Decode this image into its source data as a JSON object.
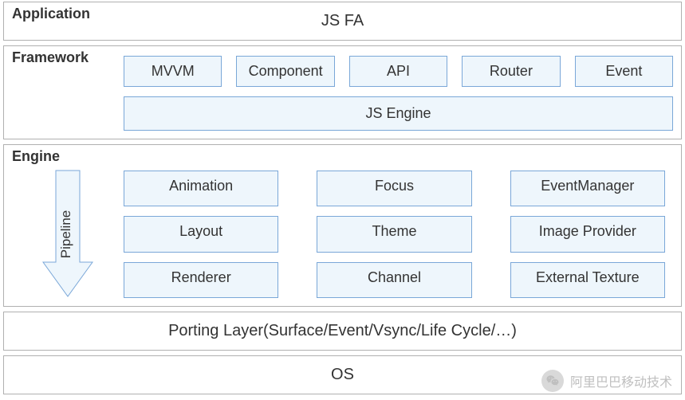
{
  "layers": {
    "application": {
      "label": "Application",
      "title": "JS FA"
    },
    "framework": {
      "label": "Framework",
      "row": [
        "MVVM",
        "Component",
        "API",
        "Router",
        "Event"
      ],
      "engine": "JS Engine"
    },
    "engine": {
      "label": "Engine",
      "pipeline_label": "Pipeline",
      "grid": [
        [
          "Animation",
          "Focus",
          "EventManager"
        ],
        [
          "Layout",
          "Theme",
          "Image Provider"
        ],
        [
          "Renderer",
          "Channel",
          "External Texture"
        ]
      ]
    },
    "porting": "Porting Layer(Surface/Event/Vsync/Life Cycle/…)",
    "os": "OS"
  },
  "watermark": "阿里巴巴移动技术",
  "colors": {
    "box_border": "#7aa7d8",
    "box_fill": "#eef6fc",
    "layer_border": "#b0b0b0",
    "arrow": "#bcd4ea"
  }
}
